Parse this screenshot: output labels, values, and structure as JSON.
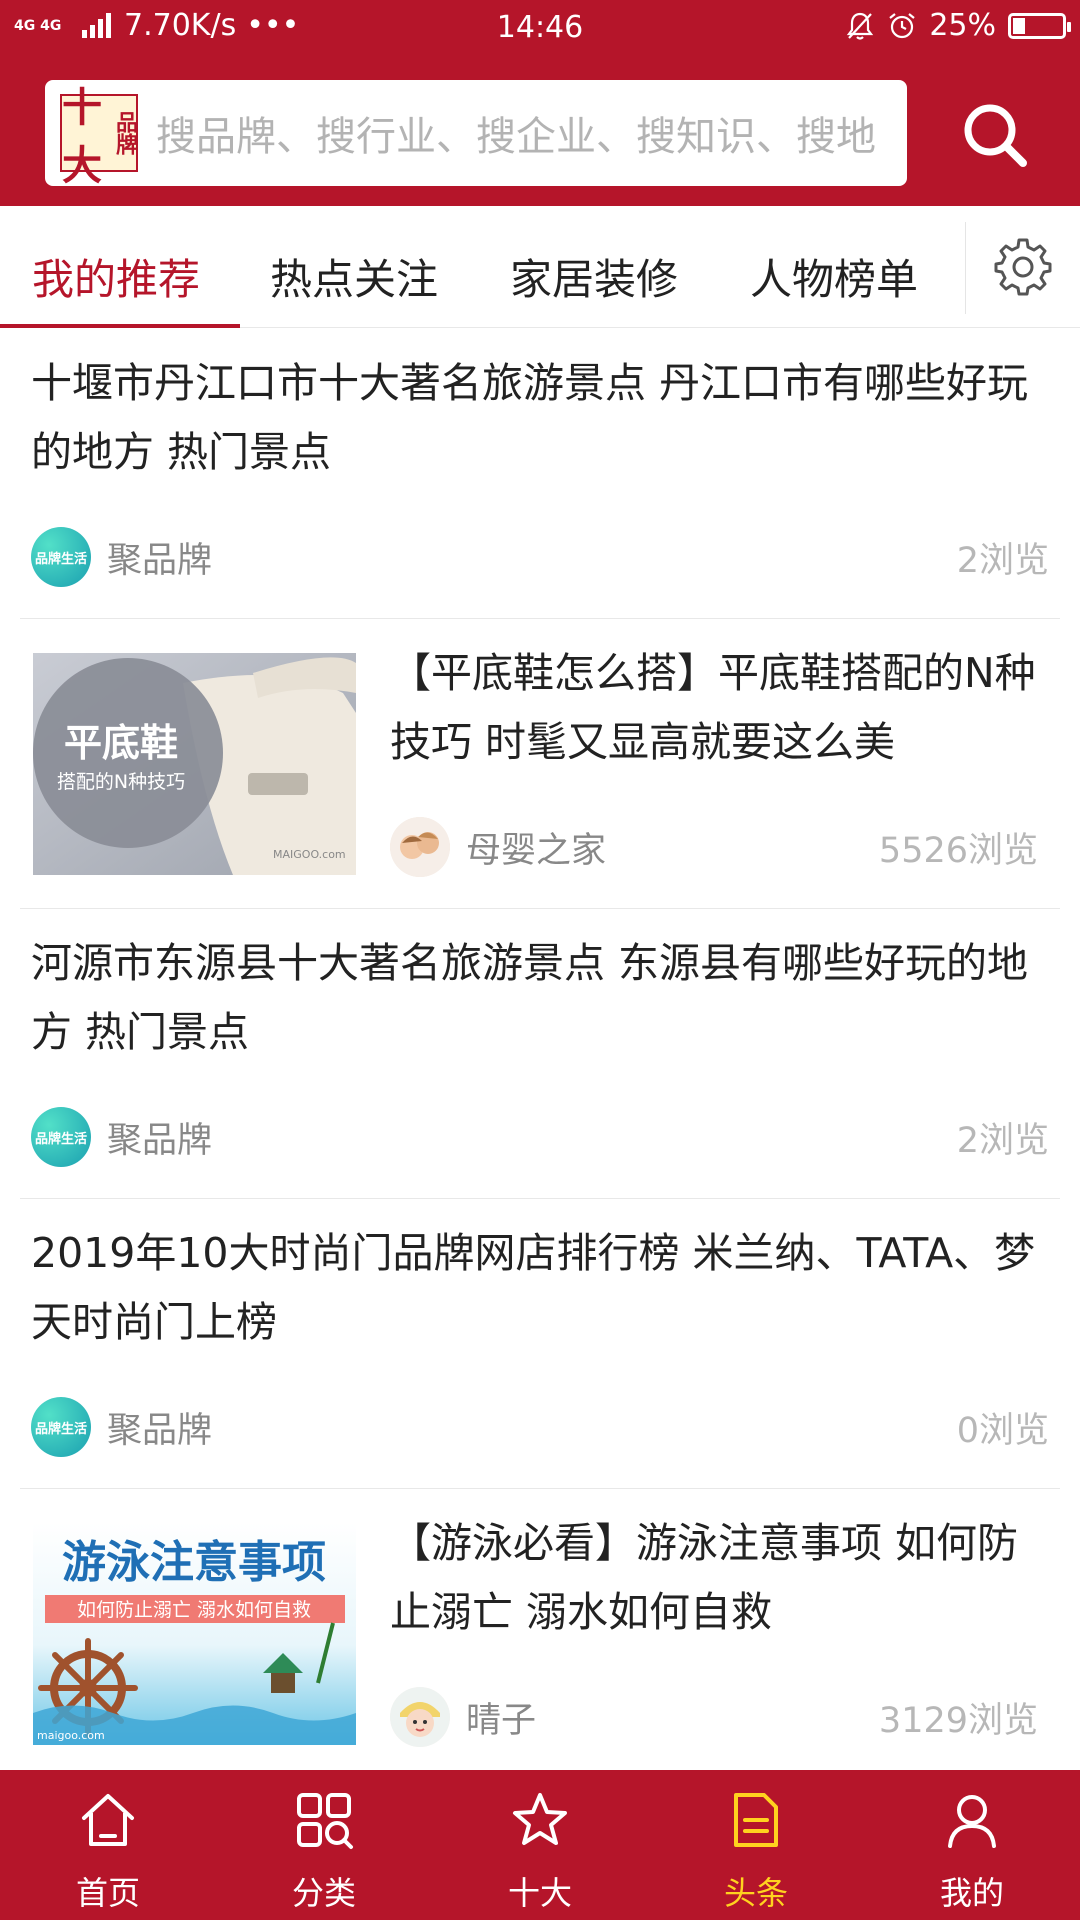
{
  "status_bar": {
    "network": "4G 4G",
    "speed": "7.70K/s",
    "dots": "•••",
    "time": "14:46",
    "battery": "25%",
    "battery_level": 0.25
  },
  "search": {
    "logo_big": "十大",
    "logo_small": "品牌",
    "placeholder": "搜品牌、搜行业、搜企业、搜知识、搜地"
  },
  "tabs": [
    {
      "label": "我的推荐",
      "active": true
    },
    {
      "label": "热点关注",
      "active": false
    },
    {
      "label": "家居装修",
      "active": false
    },
    {
      "label": "人物榜单",
      "active": false
    }
  ],
  "feed": [
    {
      "type": "text",
      "title": "十堰市丹江口市十大著名旅游景点 丹江口市有哪些好玩的地方 热门景点",
      "source": "聚品牌",
      "avatar_text": "品牌生活",
      "views": "2浏览"
    },
    {
      "type": "thumb",
      "title": "【平底鞋怎么搭】平底鞋搭配的N种技巧 时髦又显高就要这么美",
      "source": "母婴之家",
      "views": "5526浏览",
      "thumb_title": "平底鞋",
      "thumb_sub": "搭配的N种技巧",
      "thumb_mark": "MAIGOO.com"
    },
    {
      "type": "text",
      "title": "河源市东源县十大著名旅游景点 东源县有哪些好玩的地方 热门景点",
      "source": "聚品牌",
      "avatar_text": "品牌生活",
      "views": "2浏览"
    },
    {
      "type": "text",
      "title": "2019年10大时尚门品牌网店排行榜 米兰纳、TATA、梦天时尚门上榜",
      "source": "聚品牌",
      "avatar_text": "品牌生活",
      "views": "0浏览"
    },
    {
      "type": "thumb",
      "title": "【游泳必看】游泳注意事项 如何防止溺亡 溺水如何自救",
      "source": "晴子",
      "views": "3129浏览",
      "thumb_title": "游泳注意事项",
      "thumb_sub": "如何防止溺亡 溺水如何自救",
      "thumb_mark": "maigoo.com"
    }
  ],
  "bottom_nav": [
    {
      "label": "首页",
      "icon": "home-icon",
      "active": false
    },
    {
      "label": "分类",
      "icon": "category-icon",
      "active": false
    },
    {
      "label": "十大",
      "icon": "star-icon",
      "active": false
    },
    {
      "label": "头条",
      "icon": "news-icon",
      "active": true
    },
    {
      "label": "我的",
      "icon": "profile-icon",
      "active": false
    }
  ],
  "colors": {
    "brand_red": "#b5152a",
    "active_nav": "#ffd21f",
    "muted_text": "#888888"
  }
}
